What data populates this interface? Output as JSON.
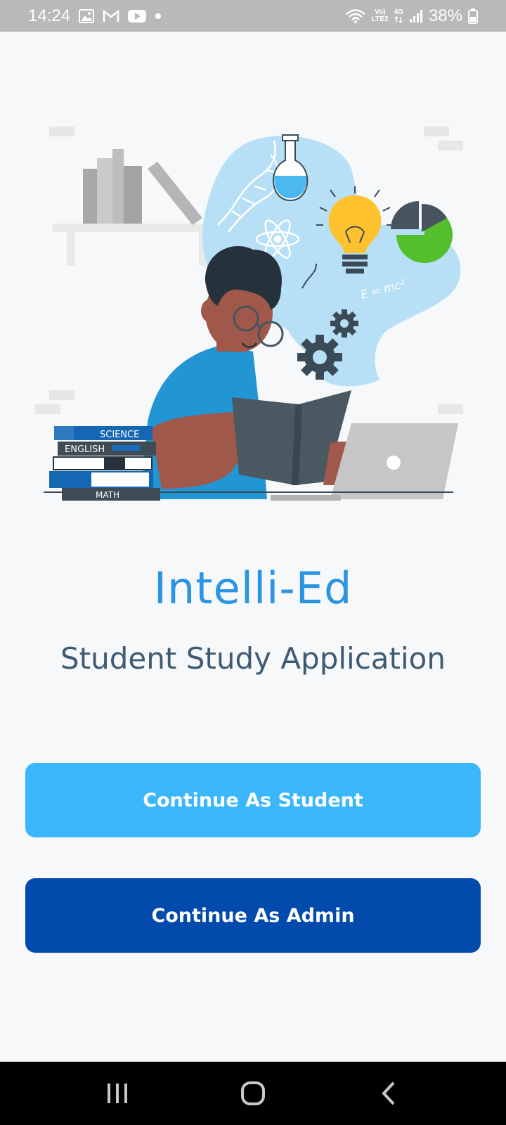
{
  "status_bar": {
    "time": "14:24",
    "network_label_top": "Vo)",
    "network_label_bottom": "LTE2",
    "network_type": "4G",
    "battery": "38%",
    "icons": [
      "gallery-icon",
      "gmail-icon",
      "youtube-icon",
      "dot-icon",
      "wifi-icon",
      "signal-icon",
      "battery-icon"
    ]
  },
  "illustration": {
    "books": [
      "SCIENCE",
      "ENGLISH",
      "MATH"
    ],
    "formula": "E = mc²"
  },
  "app": {
    "title": "Intelli-Ed",
    "subtitle": "Student Study Application"
  },
  "buttons": {
    "student_label": "Continue As Student",
    "admin_label": "Continue As Admin"
  },
  "colors": {
    "title": "#2b95e3",
    "subtitle": "#3f5a73",
    "student_button": "#3ab6fb",
    "admin_button": "#034aad",
    "background": "#f6f8fa"
  },
  "nav_bar": {
    "icons": [
      "recent-apps-icon",
      "home-icon",
      "back-icon"
    ]
  }
}
